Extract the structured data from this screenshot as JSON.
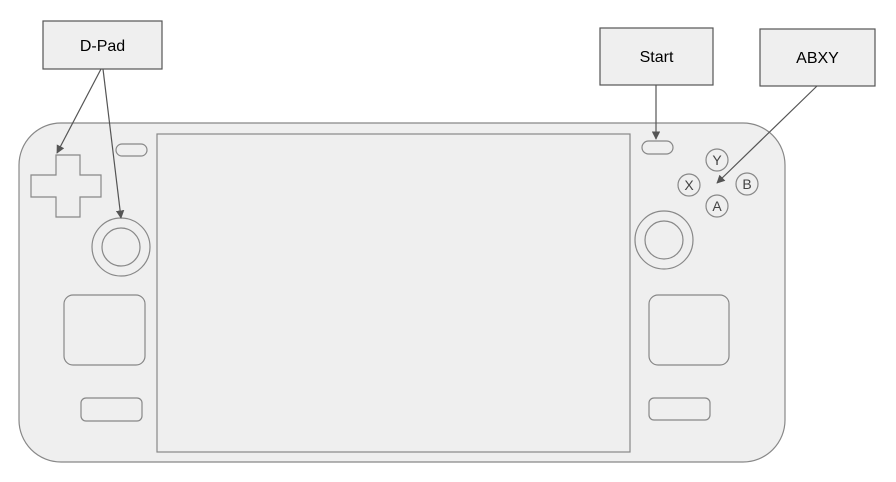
{
  "labels": {
    "dpad": "D-Pad",
    "start": "Start",
    "abxy": "ABXY"
  },
  "face_buttons": {
    "y": "Y",
    "x": "X",
    "b": "B",
    "a": "A"
  },
  "colors": {
    "body_fill": "#efefef",
    "outline": "#888888",
    "arrow": "#555555",
    "label_text": "#000000"
  }
}
